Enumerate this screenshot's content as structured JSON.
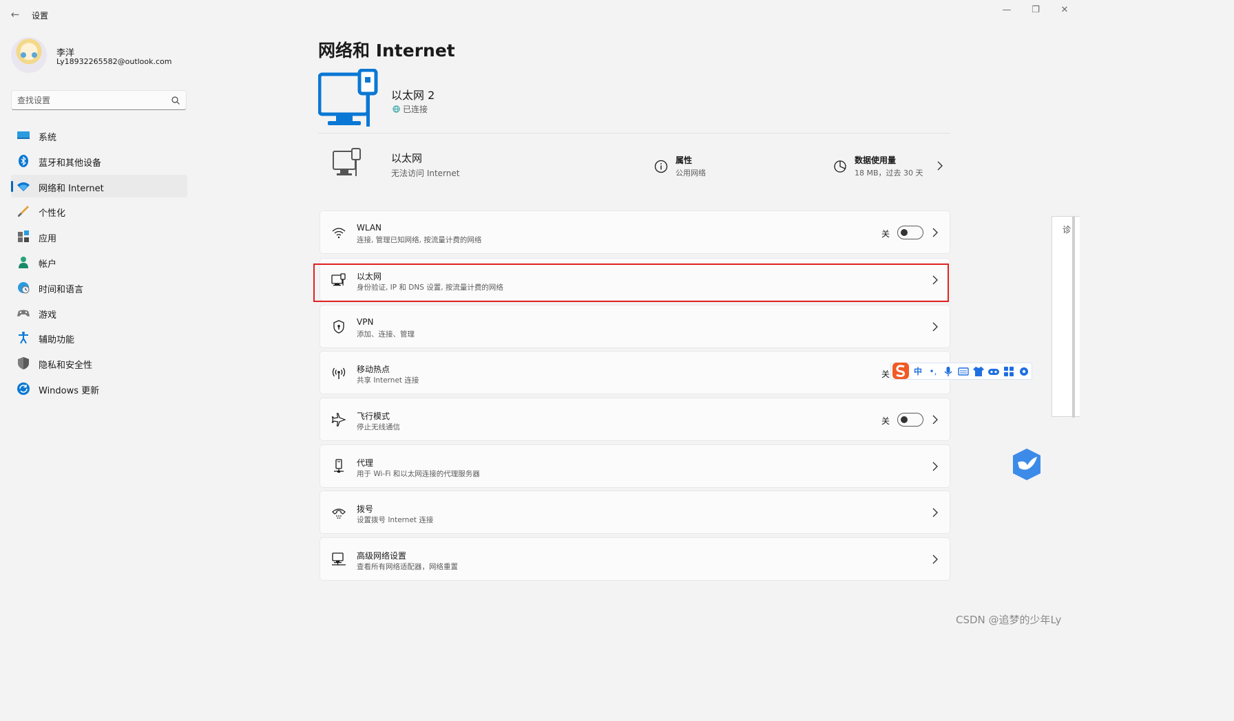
{
  "titlebar": {
    "app_title": "设置",
    "minimize_glyph": "—",
    "restore_glyph": "❐",
    "close_glyph": "✕",
    "back_glyph": "←"
  },
  "profile": {
    "name": "李洋",
    "email": "Ly18932265582@outlook.com"
  },
  "search": {
    "placeholder": "查找设置"
  },
  "sidebar": {
    "items": [
      {
        "label": "系统",
        "icon": "display-icon"
      },
      {
        "label": "蓝牙和其他设备",
        "icon": "bluetooth-icon"
      },
      {
        "label": "网络和 Internet",
        "icon": "wifi-icon"
      },
      {
        "label": "个性化",
        "icon": "brush-icon"
      },
      {
        "label": "应用",
        "icon": "apps-icon"
      },
      {
        "label": "帐户",
        "icon": "person-icon"
      },
      {
        "label": "时间和语言",
        "icon": "globe-clock-icon"
      },
      {
        "label": "游戏",
        "icon": "gamepad-icon"
      },
      {
        "label": "辅助功能",
        "icon": "accessibility-icon"
      },
      {
        "label": "隐私和安全性",
        "icon": "shield-icon"
      },
      {
        "label": "Windows 更新",
        "icon": "update-icon"
      }
    ],
    "active_index": 2
  },
  "main": {
    "page_title": "网络和 Internet",
    "hero": {
      "name": "以太网 2",
      "status": "已连接"
    },
    "ethernet_summary": {
      "name": "以太网",
      "description": "无法访问 Internet",
      "properties_label": "属性",
      "properties_value": "公用网络",
      "usage_label": "数据使用量",
      "usage_value": "18 MB，过去 30 天"
    },
    "cards": [
      {
        "title": "WLAN",
        "subtitle": "连接, 管理已知网络, 按流量计费的网络",
        "toggle_label": "关",
        "has_toggle": true
      },
      {
        "title": "以太网",
        "subtitle": "身份验证, IP 和 DNS 设置, 按流量计费的网络",
        "highlighted": true
      },
      {
        "title": "VPN",
        "subtitle": "添加、连接、管理"
      },
      {
        "title": "移动热点",
        "subtitle": "共享 Internet 连接",
        "toggle_label": "关"
      },
      {
        "title": "飞行模式",
        "subtitle": "停止无线通信",
        "toggle_label": "关",
        "has_toggle": true
      },
      {
        "title": "代理",
        "subtitle": "用于 Wi-Fi 和以太网连接的代理服务器"
      },
      {
        "title": "拨号",
        "subtitle": "设置拨号 Internet 连接"
      },
      {
        "title": "高级网络设置",
        "subtitle": "查看所有网络适配器，网络重置"
      }
    ]
  },
  "ime_toolbar": {
    "items": [
      "中",
      "•,"
    ]
  },
  "side_panel": {
    "text": "诊"
  },
  "watermark": "CSDN @追梦的少年Ly",
  "colors": {
    "accent": "#0067c0",
    "highlight_border": "#e02020",
    "background": "#f3f3f3",
    "card": "#fbfbfb"
  }
}
